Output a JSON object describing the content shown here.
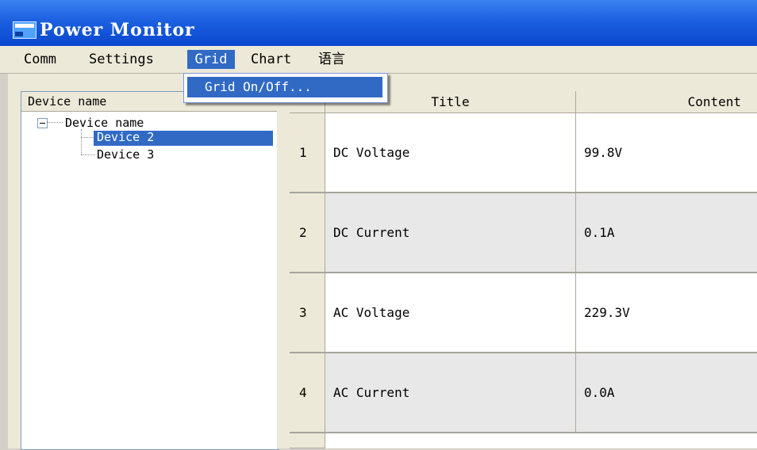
{
  "window": {
    "title": "Power Monitor"
  },
  "menubar": {
    "items": [
      "Comm",
      "Settings",
      "Grid",
      "Chart",
      "语言"
    ]
  },
  "dropdown": {
    "items": [
      "Grid On/Off..."
    ]
  },
  "tree": {
    "header": "Device name",
    "root": "Device name",
    "children": [
      "Device 2",
      "Device 3"
    ],
    "selected": "Device 2"
  },
  "grid": {
    "columns": [
      "Title",
      "Content"
    ],
    "rows": [
      {
        "index": "1",
        "title": "DC Voltage",
        "content": "99.8V"
      },
      {
        "index": "2",
        "title": "DC Current",
        "content": "0.1A"
      },
      {
        "index": "3",
        "title": "AC Voltage",
        "content": "229.3V"
      },
      {
        "index": "4",
        "title": "AC Current",
        "content": "0.0A"
      }
    ]
  },
  "colors": {
    "titlebar": "#1c5fe0",
    "selection": "#316ac5",
    "face": "#ece9d8"
  }
}
